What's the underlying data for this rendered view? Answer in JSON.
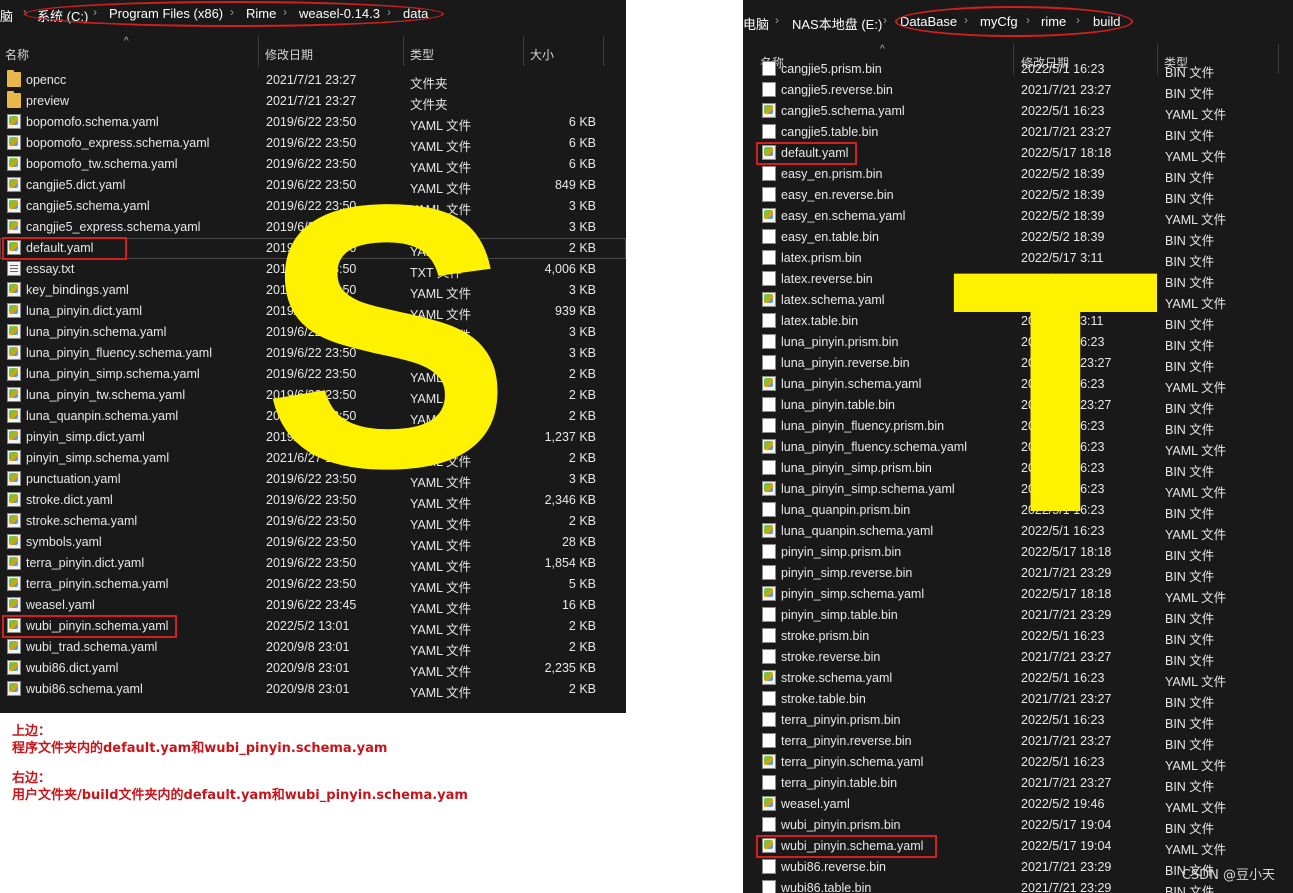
{
  "left": {
    "breadcrumb": [
      "脑",
      "系统 (C:)",
      "Program Files (x86)",
      "Rime",
      "weasel-0.14.3",
      "data"
    ],
    "columns": {
      "name": "名称",
      "date": "修改日期",
      "type": "类型",
      "size": "大小"
    },
    "files": [
      {
        "name": "opencc",
        "date": "2021/7/21 23:27",
        "type": "文件夹",
        "size": "",
        "kind": "folder"
      },
      {
        "name": "preview",
        "date": "2021/7/21 23:27",
        "type": "文件夹",
        "size": "",
        "kind": "folder"
      },
      {
        "name": "bopomofo.schema.yaml",
        "date": "2019/6/22 23:50",
        "type": "YAML 文件",
        "size": "6 KB",
        "kind": "yaml"
      },
      {
        "name": "bopomofo_express.schema.yaml",
        "date": "2019/6/22 23:50",
        "type": "YAML 文件",
        "size": "6 KB",
        "kind": "yaml"
      },
      {
        "name": "bopomofo_tw.schema.yaml",
        "date": "2019/6/22 23:50",
        "type": "YAML 文件",
        "size": "6 KB",
        "kind": "yaml"
      },
      {
        "name": "cangjie5.dict.yaml",
        "date": "2019/6/22 23:50",
        "type": "YAML 文件",
        "size": "849 KB",
        "kind": "yaml"
      },
      {
        "name": "cangjie5.schema.yaml",
        "date": "2019/6/22 23:50",
        "type": "YAML 文件",
        "size": "3 KB",
        "kind": "yaml"
      },
      {
        "name": "cangjie5_express.schema.yaml",
        "date": "2019/6/22 23:50",
        "type": "YAML 文件",
        "size": "3 KB",
        "kind": "yaml"
      },
      {
        "name": "default.yaml",
        "date": "2019/6/22 23:50",
        "type": "YAML 文件",
        "size": "2 KB",
        "kind": "yaml"
      },
      {
        "name": "essay.txt",
        "date": "2019/6/22 23:50",
        "type": "TXT 文件",
        "size": "4,006 KB",
        "kind": "txt"
      },
      {
        "name": "key_bindings.yaml",
        "date": "2019/6/22 23:50",
        "type": "YAML 文件",
        "size": "3 KB",
        "kind": "yaml"
      },
      {
        "name": "luna_pinyin.dict.yaml",
        "date": "2019/6/22 23:50",
        "type": "YAML 文件",
        "size": "939 KB",
        "kind": "yaml"
      },
      {
        "name": "luna_pinyin.schema.yaml",
        "date": "2019/6/22 23:50",
        "type": "YAML 文件",
        "size": "3 KB",
        "kind": "yaml"
      },
      {
        "name": "luna_pinyin_fluency.schema.yaml",
        "date": "2019/6/22 23:50",
        "type": "YAML 文件",
        "size": "3 KB",
        "kind": "yaml"
      },
      {
        "name": "luna_pinyin_simp.schema.yaml",
        "date": "2019/6/22 23:50",
        "type": "YAML 文件",
        "size": "2 KB",
        "kind": "yaml"
      },
      {
        "name": "luna_pinyin_tw.schema.yaml",
        "date": "2019/6/22 23:50",
        "type": "YAML 文件",
        "size": "2 KB",
        "kind": "yaml"
      },
      {
        "name": "luna_quanpin.schema.yaml",
        "date": "2019/6/22 23:50",
        "type": "YAML 文件",
        "size": "2 KB",
        "kind": "yaml"
      },
      {
        "name": "pinyin_simp.dict.yaml",
        "date": "2019/6/22 23:50",
        "type": "YAML 文件",
        "size": "1,237 KB",
        "kind": "yaml"
      },
      {
        "name": "pinyin_simp.schema.yaml",
        "date": "2021/6/27 14:29",
        "type": "YAML 文件",
        "size": "2 KB",
        "kind": "yaml"
      },
      {
        "name": "punctuation.yaml",
        "date": "2019/6/22 23:50",
        "type": "YAML 文件",
        "size": "3 KB",
        "kind": "yaml"
      },
      {
        "name": "stroke.dict.yaml",
        "date": "2019/6/22 23:50",
        "type": "YAML 文件",
        "size": "2,346 KB",
        "kind": "yaml"
      },
      {
        "name": "stroke.schema.yaml",
        "date": "2019/6/22 23:50",
        "type": "YAML 文件",
        "size": "2 KB",
        "kind": "yaml"
      },
      {
        "name": "symbols.yaml",
        "date": "2019/6/22 23:50",
        "type": "YAML 文件",
        "size": "28 KB",
        "kind": "yaml"
      },
      {
        "name": "terra_pinyin.dict.yaml",
        "date": "2019/6/22 23:50",
        "type": "YAML 文件",
        "size": "1,854 KB",
        "kind": "yaml"
      },
      {
        "name": "terra_pinyin.schema.yaml",
        "date": "2019/6/22 23:50",
        "type": "YAML 文件",
        "size": "5 KB",
        "kind": "yaml"
      },
      {
        "name": "weasel.yaml",
        "date": "2019/6/22 23:45",
        "type": "YAML 文件",
        "size": "16 KB",
        "kind": "yaml"
      },
      {
        "name": "wubi_pinyin.schema.yaml",
        "date": "2022/5/2 13:01",
        "type": "YAML 文件",
        "size": "2 KB",
        "kind": "yaml"
      },
      {
        "name": "wubi_trad.schema.yaml",
        "date": "2020/9/8 23:01",
        "type": "YAML 文件",
        "size": "2 KB",
        "kind": "yaml"
      },
      {
        "name": "wubi86.dict.yaml",
        "date": "2020/9/8 23:01",
        "type": "YAML 文件",
        "size": "2,235 KB",
        "kind": "yaml"
      },
      {
        "name": "wubi86.schema.yaml",
        "date": "2020/9/8 23:01",
        "type": "YAML 文件",
        "size": "2 KB",
        "kind": "yaml"
      }
    ],
    "big_letter": "S"
  },
  "right": {
    "breadcrumb": [
      "电脑",
      "NAS本地盘 (E:)",
      "DataBase",
      "myCfg",
      "rime",
      "build"
    ],
    "columns": {
      "name": "名称",
      "date": "修改日期",
      "type": "类型"
    },
    "files": [
      {
        "name": "cangjie5.prism.bin",
        "date": "2022/5/1 16:23",
        "type": "BIN 文件",
        "kind": "bin"
      },
      {
        "name": "cangjie5.reverse.bin",
        "date": "2021/7/21 23:27",
        "type": "BIN 文件",
        "kind": "bin"
      },
      {
        "name": "cangjie5.schema.yaml",
        "date": "2022/5/1 16:23",
        "type": "YAML 文件",
        "kind": "yaml"
      },
      {
        "name": "cangjie5.table.bin",
        "date": "2021/7/21 23:27",
        "type": "BIN 文件",
        "kind": "bin"
      },
      {
        "name": "default.yaml",
        "date": "2022/5/17 18:18",
        "type": "YAML 文件",
        "kind": "yaml"
      },
      {
        "name": "easy_en.prism.bin",
        "date": "2022/5/2 18:39",
        "type": "BIN 文件",
        "kind": "bin"
      },
      {
        "name": "easy_en.reverse.bin",
        "date": "2022/5/2 18:39",
        "type": "BIN 文件",
        "kind": "bin"
      },
      {
        "name": "easy_en.schema.yaml",
        "date": "2022/5/2 18:39",
        "type": "YAML 文件",
        "kind": "yaml"
      },
      {
        "name": "easy_en.table.bin",
        "date": "2022/5/2 18:39",
        "type": "BIN 文件",
        "kind": "bin"
      },
      {
        "name": "latex.prism.bin",
        "date": "2022/5/17 3:11",
        "type": "BIN 文件",
        "kind": "bin"
      },
      {
        "name": "latex.reverse.bin",
        "date": "2022/5/17 3:11",
        "type": "BIN 文件",
        "kind": "bin"
      },
      {
        "name": "latex.schema.yaml",
        "date": "2022/5/17 3:11",
        "type": "YAML 文件",
        "kind": "yaml"
      },
      {
        "name": "latex.table.bin",
        "date": "2022/5/17 3:11",
        "type": "BIN 文件",
        "kind": "bin"
      },
      {
        "name": "luna_pinyin.prism.bin",
        "date": "2022/5/1 16:23",
        "type": "BIN 文件",
        "kind": "bin"
      },
      {
        "name": "luna_pinyin.reverse.bin",
        "date": "2021/7/21 23:27",
        "type": "BIN 文件",
        "kind": "bin"
      },
      {
        "name": "luna_pinyin.schema.yaml",
        "date": "2022/5/1 16:23",
        "type": "YAML 文件",
        "kind": "yaml"
      },
      {
        "name": "luna_pinyin.table.bin",
        "date": "2021/7/21 23:27",
        "type": "BIN 文件",
        "kind": "bin"
      },
      {
        "name": "luna_pinyin_fluency.prism.bin",
        "date": "2022/5/1 16:23",
        "type": "BIN 文件",
        "kind": "bin"
      },
      {
        "name": "luna_pinyin_fluency.schema.yaml",
        "date": "2022/5/1 16:23",
        "type": "YAML 文件",
        "kind": "yaml"
      },
      {
        "name": "luna_pinyin_simp.prism.bin",
        "date": "2022/5/1 16:23",
        "type": "BIN 文件",
        "kind": "bin"
      },
      {
        "name": "luna_pinyin_simp.schema.yaml",
        "date": "2022/5/1 16:23",
        "type": "YAML 文件",
        "kind": "yaml"
      },
      {
        "name": "luna_quanpin.prism.bin",
        "date": "2022/5/1 16:23",
        "type": "BIN 文件",
        "kind": "bin"
      },
      {
        "name": "luna_quanpin.schema.yaml",
        "date": "2022/5/1 16:23",
        "type": "YAML 文件",
        "kind": "yaml"
      },
      {
        "name": "pinyin_simp.prism.bin",
        "date": "2022/5/17 18:18",
        "type": "BIN 文件",
        "kind": "bin"
      },
      {
        "name": "pinyin_simp.reverse.bin",
        "date": "2021/7/21 23:29",
        "type": "BIN 文件",
        "kind": "bin"
      },
      {
        "name": "pinyin_simp.schema.yaml",
        "date": "2022/5/17 18:18",
        "type": "YAML 文件",
        "kind": "yaml"
      },
      {
        "name": "pinyin_simp.table.bin",
        "date": "2021/7/21 23:29",
        "type": "BIN 文件",
        "kind": "bin"
      },
      {
        "name": "stroke.prism.bin",
        "date": "2022/5/1 16:23",
        "type": "BIN 文件",
        "kind": "bin"
      },
      {
        "name": "stroke.reverse.bin",
        "date": "2021/7/21 23:27",
        "type": "BIN 文件",
        "kind": "bin"
      },
      {
        "name": "stroke.schema.yaml",
        "date": "2022/5/1 16:23",
        "type": "YAML 文件",
        "kind": "yaml"
      },
      {
        "name": "stroke.table.bin",
        "date": "2021/7/21 23:27",
        "type": "BIN 文件",
        "kind": "bin"
      },
      {
        "name": "terra_pinyin.prism.bin",
        "date": "2022/5/1 16:23",
        "type": "BIN 文件",
        "kind": "bin"
      },
      {
        "name": "terra_pinyin.reverse.bin",
        "date": "2021/7/21 23:27",
        "type": "BIN 文件",
        "kind": "bin"
      },
      {
        "name": "terra_pinyin.schema.yaml",
        "date": "2022/5/1 16:23",
        "type": "YAML 文件",
        "kind": "yaml"
      },
      {
        "name": "terra_pinyin.table.bin",
        "date": "2021/7/21 23:27",
        "type": "BIN 文件",
        "kind": "bin"
      },
      {
        "name": "weasel.yaml",
        "date": "2022/5/2 19:46",
        "type": "YAML 文件",
        "kind": "yaml"
      },
      {
        "name": "wubi_pinyin.prism.bin",
        "date": "2022/5/17 19:04",
        "type": "BIN 文件",
        "kind": "bin"
      },
      {
        "name": "wubi_pinyin.schema.yaml",
        "date": "2022/5/17 19:04",
        "type": "YAML 文件",
        "kind": "yaml"
      },
      {
        "name": "wubi86.reverse.bin",
        "date": "2021/7/21 23:29",
        "type": "BIN 文件",
        "kind": "bin"
      },
      {
        "name": "wubi86.table.bin",
        "date": "2021/7/21 23:29",
        "type": "BIN 文件",
        "kind": "bin"
      }
    ],
    "big_letter": "T"
  },
  "notes": {
    "left_title": "上边：",
    "left_body": "程序文件夹内的default.yam和wubi_pinyin.schema.yam",
    "right_title": "右边：",
    "right_body": "用户文件夹/build文件夹内的default.yam和wubi_pinyin.schema.yam"
  },
  "watermark": "CSDN @豆小天",
  "colors": {
    "pane_bg": "#191919",
    "annotation_red": "#d41f1f",
    "letter_yellow": "#fff200",
    "note_red": "#c8151b"
  }
}
